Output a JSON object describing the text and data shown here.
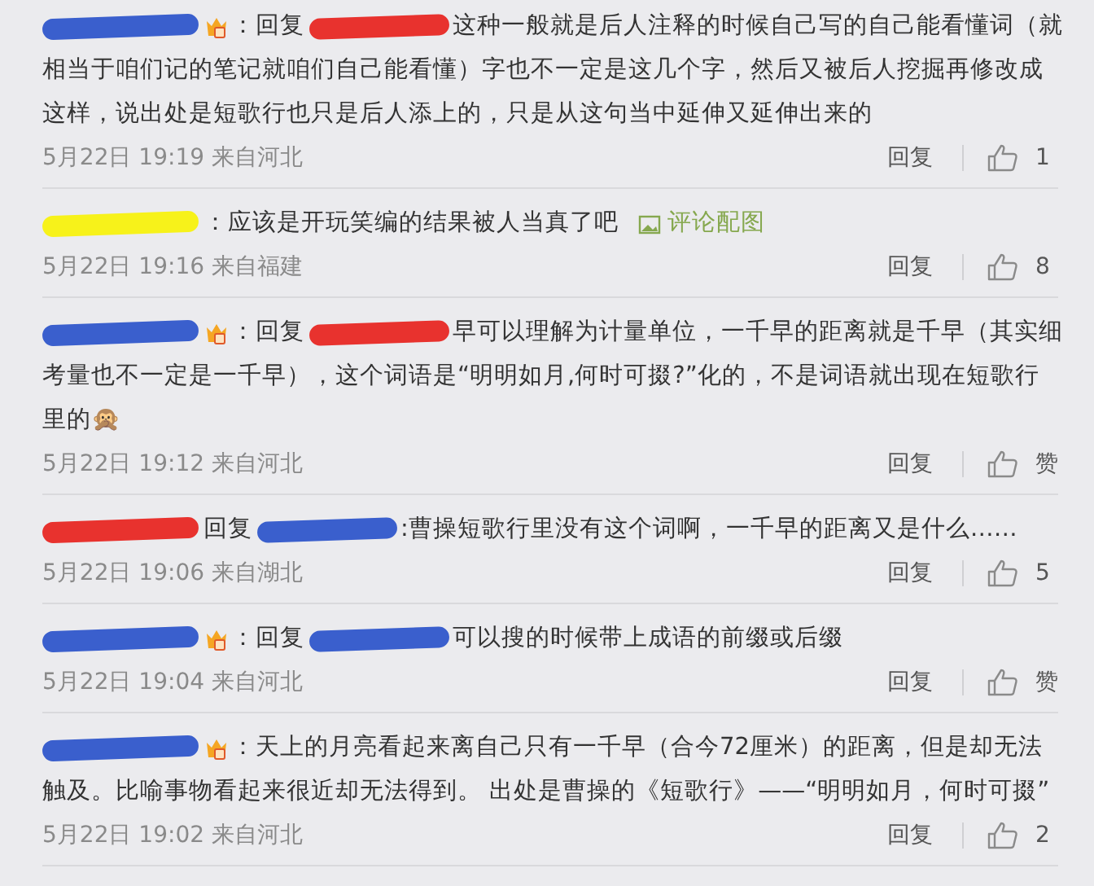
{
  "comments": [
    {
      "name": {
        "color": "#3a5fcd"
      },
      "badge": true,
      "lead": "：回复",
      "reply_to": {
        "color": "#e8322e"
      },
      "lines": [
        "这种一般就是后人注释的时候自己写的自己能看懂词（就",
        "相当于咱们记的笔记就咱们自己能看懂）字也不一定是这几个字，然后又被后人挖掘再修改成",
        "这样，说出处是短歌行也只是后人添上的，只是从这句当中延伸又延伸出来的"
      ],
      "time": "5月22日 19:19 来自河北",
      "reply": "回复",
      "likes": "1"
    },
    {
      "name": {
        "color": "#f7f21a"
      },
      "lead": "：",
      "lines": [
        "应该是开玩笑编的结果被人当真了吧"
      ],
      "image_link": "评论配图",
      "time": "5月22日 19:16 来自福建",
      "reply": "回复",
      "likes": "8"
    },
    {
      "name": {
        "color": "#3a5fcd"
      },
      "badge": true,
      "lead": "：回复",
      "reply_to": {
        "color": "#e8322e"
      },
      "lines": [
        "早可以理解为计量单位，一千早的距离就是千早（其实细",
        "考量也不一定是一千早），这个词语是“明明如月,何时可掇?”化的，不是词语就出现在短歌行",
        "里的🙊"
      ],
      "time": "5月22日 19:12 来自河北",
      "reply": "回复",
      "likes": "赞"
    },
    {
      "name": {
        "color": "#e8322e"
      },
      "lead": "回复",
      "reply_to": {
        "color": "#3a5fcd"
      },
      "lines": [
        ":曹操短歌行里没有这个词啊，一千早的距离又是什么……"
      ],
      "time": "5月22日 19:06 来自湖北",
      "reply": "回复",
      "likes": "5"
    },
    {
      "name": {
        "color": "#3a5fcd"
      },
      "badge": true,
      "lead": "：回复",
      "reply_to": {
        "color": "#3a5fcd"
      },
      "lines": [
        "可以搜的时候带上成语的前缀或后缀"
      ],
      "time": "5月22日 19:04 来自河北",
      "reply": "回复",
      "likes": "赞"
    },
    {
      "name": {
        "color": "#3a5fcd"
      },
      "badge": true,
      "lead": "：",
      "lines": [
        "天上的月亮看起来离自己只有一千早（合今72厘米）的距离，但是却无法",
        "触及。比喻事物看起来很近却无法得到。 出处是曹操的《短歌行》——“明明如月，何时可掇”"
      ],
      "time": "5月22日 19:02 来自河北",
      "reply": "回复",
      "likes": "2"
    }
  ]
}
